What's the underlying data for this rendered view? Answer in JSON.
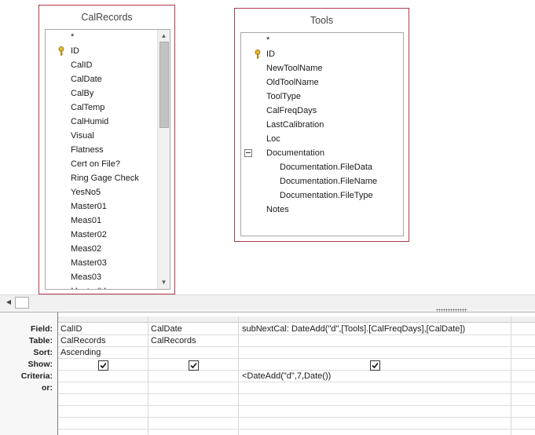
{
  "tables": [
    {
      "name": "CalRecords",
      "fields": [
        "*",
        "ID",
        "CalID",
        "CalDate",
        "CalBy",
        "CalTemp",
        "CalHumid",
        "Visual",
        "Flatness",
        "Cert on File?",
        "Ring Gage Check",
        "YesNo5",
        "Master01",
        "Meas01",
        "Master02",
        "Meas02",
        "Master03",
        "Meas03"
      ]
    },
    {
      "name": "Tools",
      "fields": [
        "*",
        "ID",
        "NewToolName",
        "OldToolName",
        "ToolType",
        "CalFreqDays",
        "LastCalibration",
        "Loc",
        "Documentation",
        "Documentation.FileData",
        "Documentation.FileName",
        "Documentation.FileType",
        "Notes"
      ]
    }
  ],
  "grid": {
    "row_headers": [
      "Field:",
      "Table:",
      "Sort:",
      "Show:",
      "Criteria:",
      "or:"
    ],
    "columns": [
      {
        "field": "CalID",
        "table": "CalRecords",
        "sort": "Ascending",
        "show": true,
        "criteria": ""
      },
      {
        "field": "CalDate",
        "table": "CalRecords",
        "sort": "",
        "show": true,
        "criteria": ""
      },
      {
        "field": "subNextCal: DateAdd(\"d\",[Tools].[CalFreqDays],[CalDate])",
        "table": "",
        "sort": "",
        "show": true,
        "criteria": "<DateAdd(\"d\",7,Date())"
      }
    ]
  },
  "icons": {
    "primary_key": "key-icon",
    "collapse": "minus-icon",
    "scroll_up": "up-arrow-icon",
    "scroll_down": "down-arrow-icon",
    "scroll_left": "left-arrow-icon"
  },
  "colors": {
    "table_border": "#b23b4b",
    "key_icon": "#c9a227"
  }
}
